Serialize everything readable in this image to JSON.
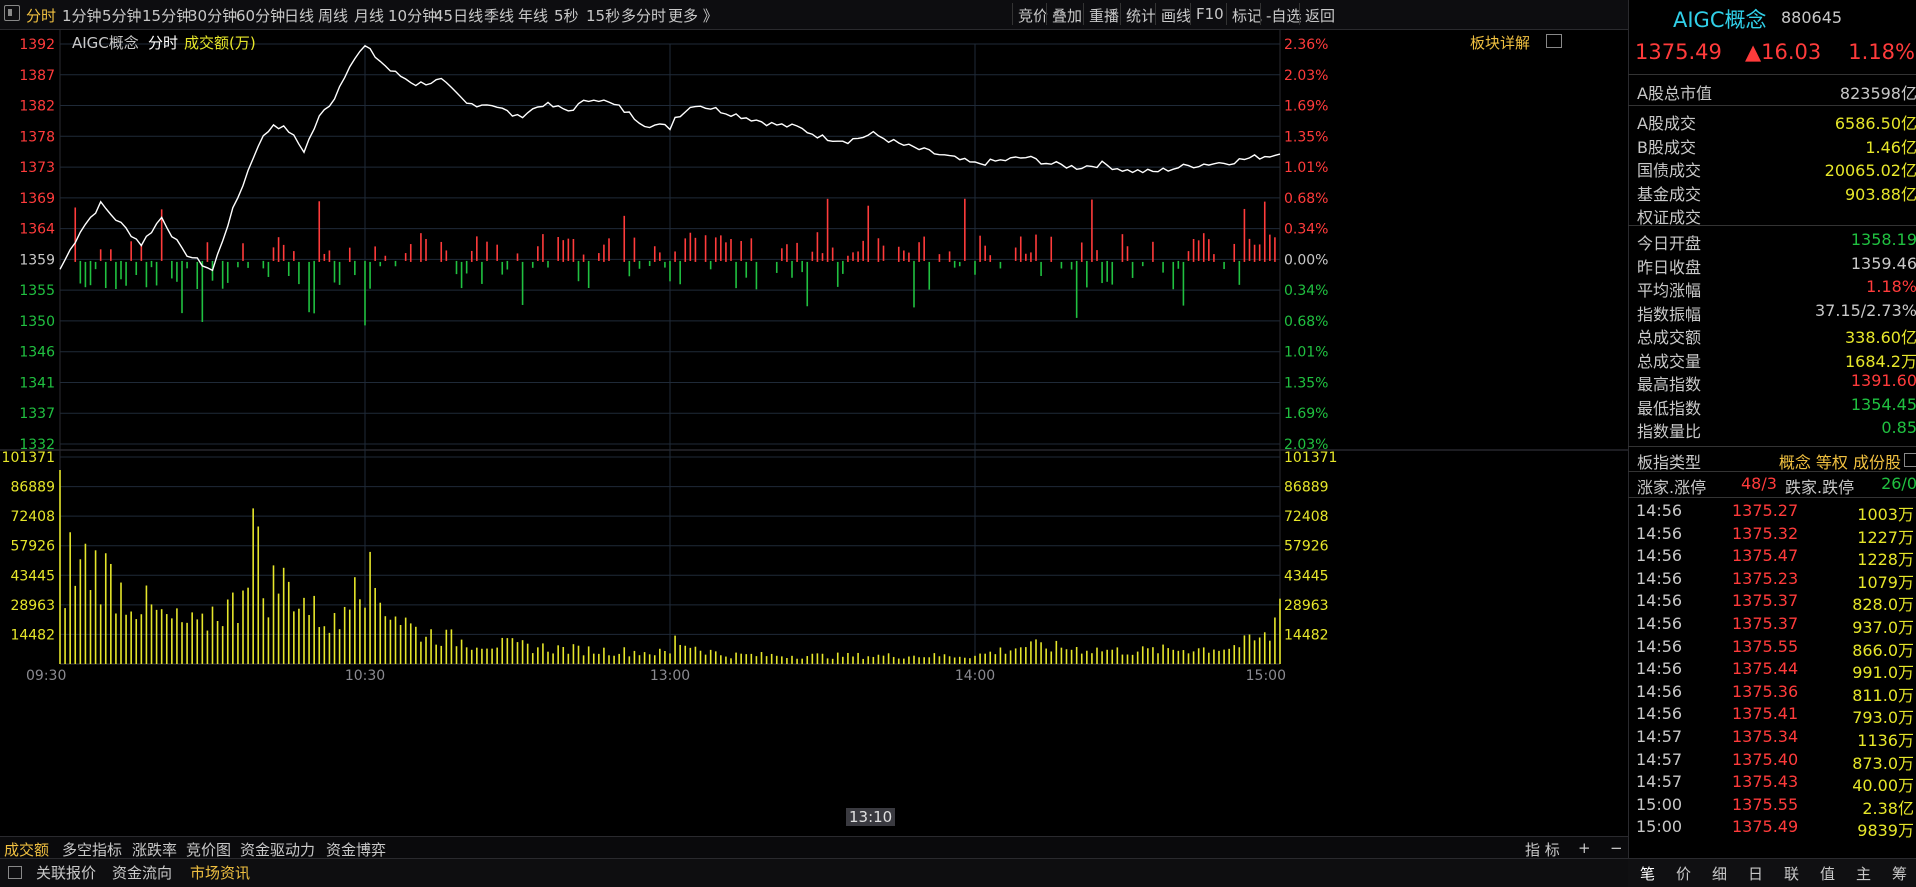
{
  "colors": {
    "up": "#ff3b3b",
    "down": "#20c040",
    "yellow": "#e6e62a",
    "gold": "#f0c040",
    "line": "#ffffff",
    "cyan": "#31d0e8",
    "grid": "#1f2a38"
  },
  "toolbar": {
    "periods": [
      "分时",
      "1分钟",
      "5分钟",
      "15分钟",
      "30分钟",
      "60分钟",
      "日线",
      "周线",
      "月线",
      "10分钟",
      "45日线",
      "季线",
      "年线",
      "5秒",
      "15秒",
      "多分时",
      "更多 》"
    ],
    "active_period": "分时",
    "tools": [
      "竞价",
      "叠加",
      "重播",
      "统计",
      "画线",
      "F10",
      "标记",
      "-自选",
      "返回"
    ]
  },
  "chart_header": {
    "name": "AIGC概念",
    "mode": "分时",
    "indicator": "成交额(万)",
    "detail_link": "板块详解"
  },
  "price_axis": {
    "left": [
      "1392",
      "1387",
      "1382",
      "1378",
      "1373",
      "1369",
      "1364",
      "1359",
      "1355",
      "1350",
      "1346",
      "1341",
      "1337",
      "1332"
    ],
    "right": [
      "2.36%",
      "2.03%",
      "1.69%",
      "1.35%",
      "1.01%",
      "0.68%",
      "0.34%",
      "0.00%",
      "0.34%",
      "0.68%",
      "1.01%",
      "1.35%",
      "1.69%",
      "2.03%"
    ]
  },
  "volume_axis": [
    "101371",
    "86889",
    "72408",
    "57926",
    "43445",
    "28963",
    "14482"
  ],
  "time_axis": [
    "09:30",
    "10:30",
    "13:00",
    "14:00",
    "15:00"
  ],
  "crosshair_time": "13:10",
  "bottom_tabs": [
    "成交额",
    "多空指标",
    "涨跌率",
    "竞价图",
    "资金驱动力",
    "资金博弈"
  ],
  "bottom_tabs_right": {
    "indicator": "指 标",
    "plus": "+",
    "minus": "−"
  },
  "footer_tabs": [
    "关联报价",
    "资金流向",
    "市场资讯"
  ],
  "right_panel": {
    "title": "AIGC概念",
    "code": "880645",
    "price": "1375.49",
    "change": "▲16.03",
    "change_pct": "1.18%",
    "market_cap_label": "A股总市值",
    "market_cap": "823598亿",
    "turnover": [
      {
        "label": "A股成交",
        "value": "6586.50亿"
      },
      {
        "label": "B股成交",
        "value": "1.46亿"
      },
      {
        "label": "国债成交",
        "value": "20065.02亿"
      },
      {
        "label": "基金成交",
        "value": "903.88亿"
      },
      {
        "label": "权证成交",
        "value": ""
      }
    ],
    "stats": [
      {
        "label": "今日开盘",
        "value": "1358.19",
        "color": "#20c040"
      },
      {
        "label": "昨日收盘",
        "value": "1359.46",
        "color": "#c8c8c8"
      },
      {
        "label": "平均涨幅",
        "value": "1.18%",
        "color": "#ff3b3b"
      },
      {
        "label": "指数振幅",
        "value": "37.15/2.73%",
        "color": "#c8c8c8"
      },
      {
        "label": "总成交额",
        "value": "338.60亿",
        "color": "#e6e62a"
      },
      {
        "label": "总成交量",
        "value": "1684.2万",
        "color": "#e6e62a"
      },
      {
        "label": "最高指数",
        "value": "1391.60",
        "color": "#ff3b3b"
      },
      {
        "label": "最低指数",
        "value": "1354.45",
        "color": "#20c040"
      },
      {
        "label": "指数量比",
        "value": "0.85",
        "color": "#20c040"
      }
    ],
    "type_label": "板指类型",
    "type_value": "概念 等权 成份股",
    "rise_label": "涨家.涨停",
    "rise_value": "48/3",
    "fall_label": "跌家.跌停",
    "fall_value": "26/0",
    "ticks": [
      {
        "time": "14:56",
        "price": "1375.27",
        "vol": "1003万"
      },
      {
        "time": "14:56",
        "price": "1375.32",
        "vol": "1227万"
      },
      {
        "time": "14:56",
        "price": "1375.47",
        "vol": "1228万"
      },
      {
        "time": "14:56",
        "price": "1375.23",
        "vol": "1079万"
      },
      {
        "time": "14:56",
        "price": "1375.37",
        "vol": "828.0万"
      },
      {
        "time": "14:56",
        "price": "1375.37",
        "vol": "937.0万"
      },
      {
        "time": "14:56",
        "price": "1375.55",
        "vol": "866.0万"
      },
      {
        "time": "14:56",
        "price": "1375.44",
        "vol": "991.0万"
      },
      {
        "time": "14:56",
        "price": "1375.36",
        "vol": "811.0万"
      },
      {
        "time": "14:56",
        "price": "1375.41",
        "vol": "793.0万"
      },
      {
        "time": "14:57",
        "price": "1375.34",
        "vol": "1136万"
      },
      {
        "time": "14:57",
        "price": "1375.40",
        "vol": "873.0万"
      },
      {
        "time": "14:57",
        "price": "1375.43",
        "vol": "40.00万"
      },
      {
        "time": "15:00",
        "price": "1375.55",
        "vol": "2.38亿"
      },
      {
        "time": "15:00",
        "price": "1375.49",
        "vol": "9839万"
      }
    ],
    "tabs": [
      "笔",
      "价",
      "细",
      "日",
      "联",
      "值",
      "主",
      "筹"
    ]
  },
  "chart_data": {
    "type": "line",
    "x_range": [
      "09:30",
      "15:00"
    ],
    "price_ylim": [
      1332,
      1392
    ],
    "prev_close": 1359.46,
    "price_points": [
      [
        "09:30",
        1358.2
      ],
      [
        "09:34",
        1364
      ],
      [
        "09:38",
        1368
      ],
      [
        "09:42",
        1365
      ],
      [
        "09:46",
        1362
      ],
      [
        "09:50",
        1366
      ],
      [
        "09:54",
        1361
      ],
      [
        "09:58",
        1359
      ],
      [
        "10:00",
        1358
      ],
      [
        "10:03",
        1365
      ],
      [
        "10:06",
        1371
      ],
      [
        "10:09",
        1377
      ],
      [
        "10:12",
        1380
      ],
      [
        "10:15",
        1379
      ],
      [
        "10:18",
        1376
      ],
      [
        "10:21",
        1381
      ],
      [
        "10:24",
        1384
      ],
      [
        "10:27",
        1389
      ],
      [
        "10:30",
        1391.6
      ],
      [
        "10:35",
        1388
      ],
      [
        "10:40",
        1386
      ],
      [
        "10:45",
        1386.5
      ],
      [
        "10:50",
        1383
      ],
      [
        "10:55",
        1383
      ],
      [
        "11:00",
        1381
      ],
      [
        "11:05",
        1383
      ],
      [
        "11:10",
        1382
      ],
      [
        "11:15",
        1384
      ],
      [
        "11:20",
        1382.5
      ],
      [
        "11:25",
        1380
      ],
      [
        "11:30",
        1379.5
      ],
      [
        "13:00",
        1380.5
      ],
      [
        "13:05",
        1383
      ],
      [
        "13:10",
        1382
      ],
      [
        "13:15",
        1381
      ],
      [
        "13:20",
        1380
      ],
      [
        "13:25",
        1379.5
      ],
      [
        "13:30",
        1378
      ],
      [
        "13:35",
        1377.5
      ],
      [
        "13:40",
        1378.5
      ],
      [
        "13:45",
        1377
      ],
      [
        "13:50",
        1376
      ],
      [
        "13:55",
        1375
      ],
      [
        "14:00",
        1374
      ],
      [
        "14:05",
        1374.5
      ],
      [
        "14:10",
        1375
      ],
      [
        "14:15",
        1374
      ],
      [
        "14:20",
        1373.5
      ],
      [
        "14:25",
        1374
      ],
      [
        "14:30",
        1373
      ],
      [
        "14:35",
        1372.8
      ],
      [
        "14:40",
        1373.5
      ],
      [
        "14:45",
        1374
      ],
      [
        "14:50",
        1374.3
      ],
      [
        "14:55",
        1375
      ],
      [
        "15:00",
        1375.49
      ]
    ],
    "volume_ylim": [
      0,
      101371
    ],
    "volume_profile": [
      [
        "09:30",
        95000
      ],
      [
        "09:31",
        45000
      ],
      [
        "09:32",
        58000
      ],
      [
        "09:33",
        48000
      ],
      [
        "09:35",
        55000
      ],
      [
        "09:38",
        52000
      ],
      [
        "09:42",
        40000
      ],
      [
        "09:46",
        33000
      ],
      [
        "09:50",
        25000
      ],
      [
        "09:54",
        22000
      ],
      [
        "09:58",
        20000
      ],
      [
        "10:00",
        28000
      ],
      [
        "10:05",
        32000
      ],
      [
        "10:08",
        78000
      ],
      [
        "10:10",
        38000
      ],
      [
        "10:13",
        45000
      ],
      [
        "10:16",
        40000
      ],
      [
        "10:20",
        28000
      ],
      [
        "10:25",
        20000
      ],
      [
        "10:28",
        62000
      ],
      [
        "10:30",
        48000
      ],
      [
        "10:35",
        30000
      ],
      [
        "10:40",
        18000
      ],
      [
        "10:50",
        12000
      ],
      [
        "11:00",
        10000
      ],
      [
        "11:10",
        8000
      ],
      [
        "11:20",
        7000
      ],
      [
        "11:30",
        6000
      ],
      [
        "13:00",
        14000
      ],
      [
        "13:10",
        5000
      ],
      [
        "13:30",
        4500
      ],
      [
        "14:00",
        4500
      ],
      [
        "14:10",
        10000
      ],
      [
        "14:30",
        7000
      ],
      [
        "14:50",
        9000
      ],
      [
        "14:58",
        15000
      ],
      [
        "15:00",
        32000
      ]
    ]
  }
}
